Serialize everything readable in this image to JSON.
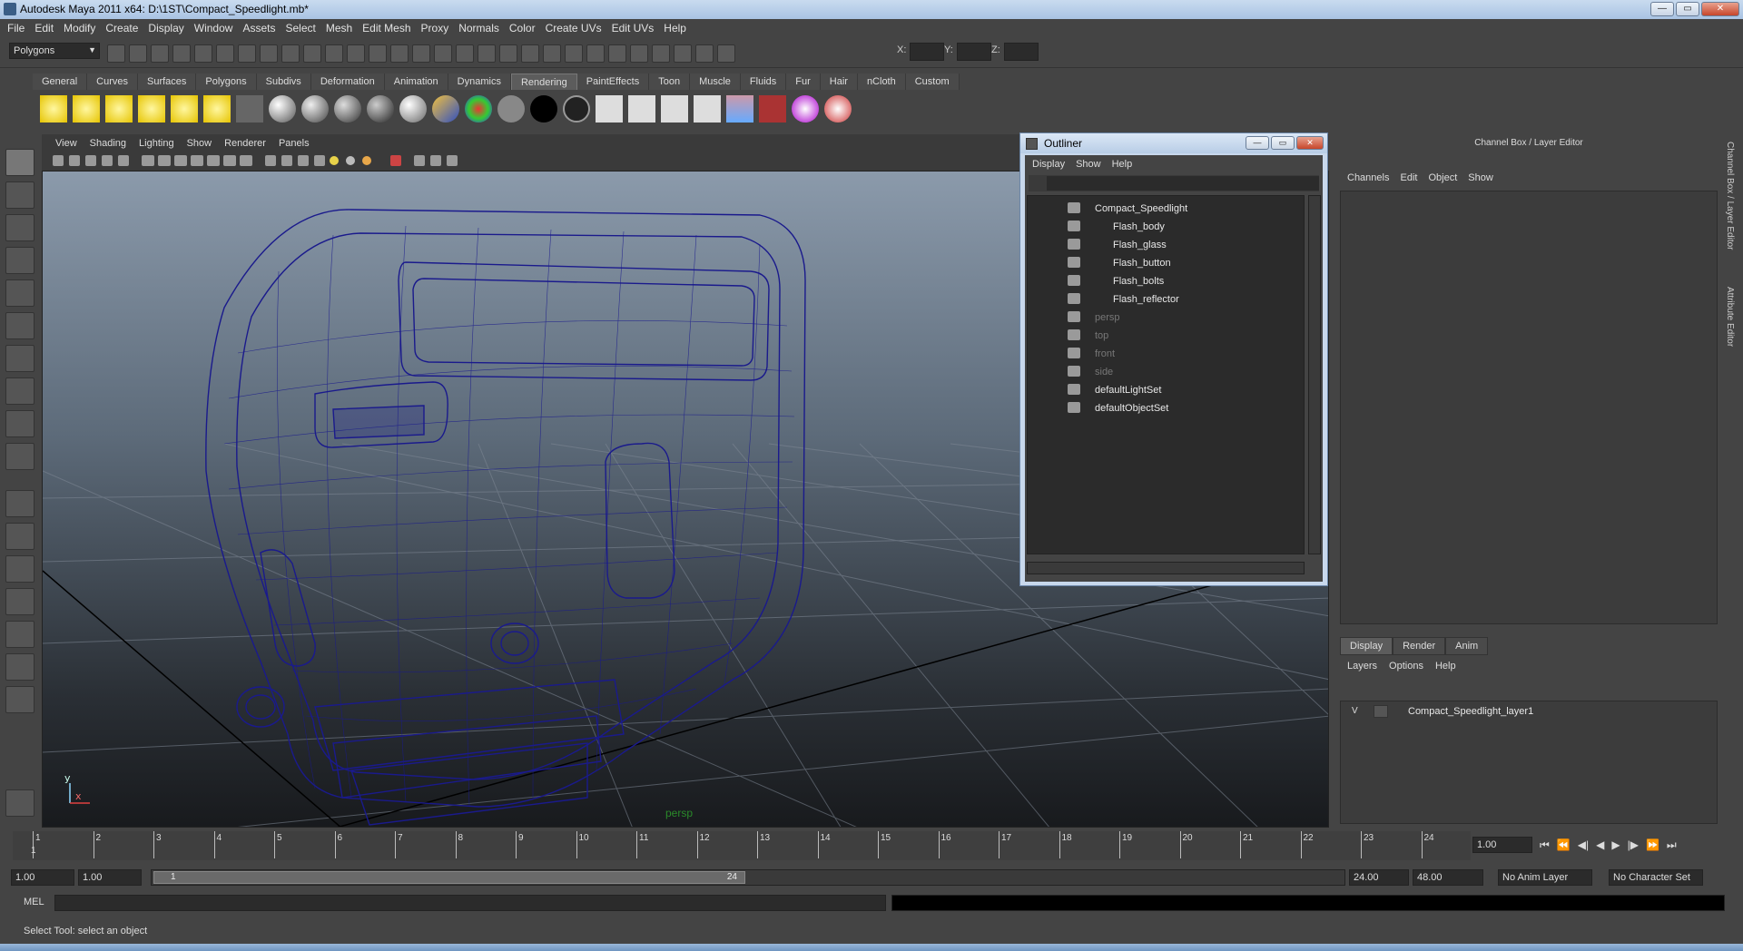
{
  "window": {
    "title": "Autodesk Maya 2011 x64: D:\\1ST\\Compact_Speedlight.mb*"
  },
  "menubar": [
    "File",
    "Edit",
    "Modify",
    "Create",
    "Display",
    "Window",
    "Assets",
    "Select",
    "Mesh",
    "Edit Mesh",
    "Proxy",
    "Normals",
    "Color",
    "Create UVs",
    "Edit UVs",
    "Help"
  ],
  "statusline": {
    "mode": "Polygons",
    "x_label": "X:",
    "y_label": "Y:",
    "z_label": "Z:"
  },
  "shelf": {
    "tabs": [
      "General",
      "Curves",
      "Surfaces",
      "Polygons",
      "Subdivs",
      "Deformation",
      "Animation",
      "Dynamics",
      "Rendering",
      "PaintEffects",
      "Toon",
      "Muscle",
      "Fluids",
      "Fur",
      "Hair",
      "nCloth",
      "Custom"
    ],
    "active_tab": "Rendering"
  },
  "viewport": {
    "menu": [
      "View",
      "Shading",
      "Lighting",
      "Show",
      "Renderer",
      "Panels"
    ],
    "camera": "persp",
    "axis_y": "y",
    "axis_x": "x",
    "wire_color": "#1a1a8c"
  },
  "outliner": {
    "title": "Outliner",
    "menu": [
      "Display",
      "Show",
      "Help"
    ],
    "items": [
      {
        "label": "Compact_Speedlight",
        "depth": 0,
        "dim": false
      },
      {
        "label": "Flash_body",
        "depth": 1,
        "dim": false
      },
      {
        "label": "Flash_glass",
        "depth": 1,
        "dim": false
      },
      {
        "label": "Flash_button",
        "depth": 1,
        "dim": false
      },
      {
        "label": "Flash_bolts",
        "depth": 1,
        "dim": false
      },
      {
        "label": "Flash_reflector",
        "depth": 1,
        "dim": false
      },
      {
        "label": "persp",
        "depth": 0,
        "dim": true
      },
      {
        "label": "top",
        "depth": 0,
        "dim": true
      },
      {
        "label": "front",
        "depth": 0,
        "dim": true
      },
      {
        "label": "side",
        "depth": 0,
        "dim": true
      },
      {
        "label": "defaultLightSet",
        "depth": 0,
        "dim": false
      },
      {
        "label": "defaultObjectSet",
        "depth": 0,
        "dim": false
      }
    ]
  },
  "channelbox": {
    "title": "Channel Box / Layer Editor",
    "menu": [
      "Channels",
      "Edit",
      "Object",
      "Show"
    ],
    "layer_tabs": [
      "Display",
      "Render",
      "Anim"
    ],
    "layer_menu": [
      "Layers",
      "Options",
      "Help"
    ],
    "layer": {
      "visible": "V",
      "name": "Compact_Speedlight_layer1"
    },
    "side_tabs": [
      "Channel Box / Layer Editor",
      "Attribute Editor"
    ]
  },
  "timeline": {
    "ticks": [
      "1",
      "2",
      "3",
      "4",
      "5",
      "6",
      "7",
      "8",
      "9",
      "10",
      "11",
      "12",
      "13",
      "14",
      "15",
      "16",
      "17",
      "18",
      "19",
      "20",
      "21",
      "22",
      "23",
      "24"
    ],
    "current_marker": "1",
    "current_frame": "1.00"
  },
  "range": {
    "start": "1.00",
    "start2": "1.00",
    "handle_start": "1",
    "handle_end": "24",
    "end": "24.00",
    "end2": "48.00",
    "anim_layer": "No Anim Layer",
    "char_set": "No Character Set"
  },
  "cmdline": {
    "label": "MEL"
  },
  "helpline": {
    "text": "Select Tool: select an object"
  }
}
